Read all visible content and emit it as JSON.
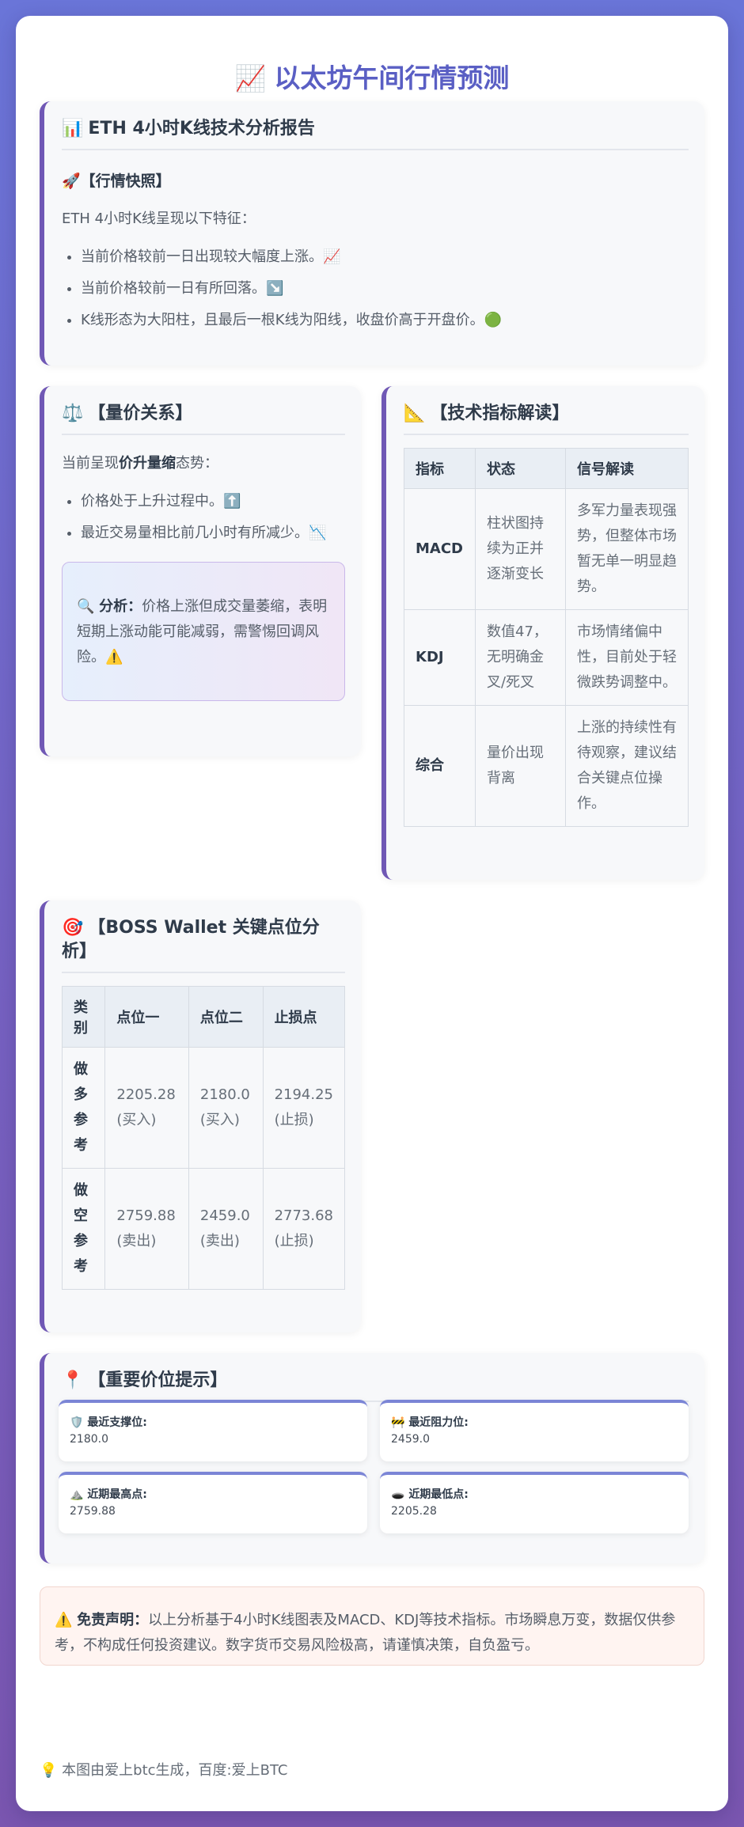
{
  "title": {
    "icon": "📈",
    "text": "以太坊午间行情预测"
  },
  "report": {
    "icon": "📊",
    "heading": "ETH 4小时K线技术分析报告",
    "snapshot_icon": "🚀",
    "snapshot_heading": "【行情快照】",
    "intro": "ETH 4小时K线呈现以下特征：",
    "bullets": [
      "当前价格较前一日出现较大幅度上涨。📈",
      "当前价格较前一日有所回落。↘️",
      "K线形态为大阳柱，且最后一根K线为阳线，收盘价高于开盘价。🟢"
    ]
  },
  "volume_price": {
    "icon": "⚖️",
    "heading": "【量价关系】",
    "intro_pre": "当前呈现",
    "intro_bold": "价升量缩",
    "intro_post": "态势：",
    "bullets": [
      "价格处于上升过程中。⬆️",
      "最近交易量相比前几小时有所减少。📉"
    ],
    "analysis_icon": "🔍",
    "analysis_label": "分析：",
    "analysis_text": "价格上涨但成交量萎缩，表明短期上涨动能可能减弱，需警惕回调风险。⚠️"
  },
  "indicators": {
    "icon": "📐",
    "heading": "【技术指标解读】",
    "headers": [
      "指标",
      "状态",
      "信号解读"
    ],
    "rows": [
      {
        "name": "MACD",
        "state": "柱状图持续为正并逐渐变长",
        "signal": "多军力量表现强势，但整体市场暂无单一明显趋势。"
      },
      {
        "name": "KDJ",
        "state": "数值47，无明确金叉/死叉",
        "signal": "市场情绪偏中性，目前处于轻微跌势调整中。"
      },
      {
        "name": "综合",
        "state": "量价出现背离",
        "signal": "上涨的持续性有待观察，建议结合关键点位操作。"
      }
    ]
  },
  "boss": {
    "icon": "🎯",
    "heading": "【BOSS Wallet 关键点位分析】",
    "headers": [
      "类别",
      "点位一",
      "点位二",
      "止损点"
    ],
    "rows": [
      {
        "cat": "做多参考",
        "p1": "2205.28 (买入)",
        "p2": "2180.0 (买入)",
        "stop": "2194.25 (止损)"
      },
      {
        "cat": "做空参考",
        "p1": "2759.88 (卖出)",
        "p2": "2459.0 (卖出)",
        "stop": "2773.68 (止损)"
      }
    ]
  },
  "levels": {
    "icon": "📍",
    "heading": "【重要价位提示】",
    "items": [
      {
        "icon": "🛡️",
        "label": "最近支撑位:",
        "value": "2180.0"
      },
      {
        "icon": "🚧",
        "label": "最近阻力位:",
        "value": "2459.0"
      },
      {
        "icon": "⛰️",
        "label": "近期最高点:",
        "value": "2759.88"
      },
      {
        "icon": "🕳️",
        "label": "近期最低点:",
        "value": "2205.28"
      }
    ]
  },
  "disclaimer": {
    "icon": "⚠️",
    "label": "免责声明：",
    "text": "以上分析基于4小时K线图表及MACD、KDJ等技术指标。市场瞬息万变，数据仅供参考，不构成任何投资建议。数字货币交易风险极高，请谨慎决策，自负盈亏。"
  },
  "footer": {
    "icon": "💡",
    "text": "本图由爱上btc生成，百度:爱上BTC"
  }
}
